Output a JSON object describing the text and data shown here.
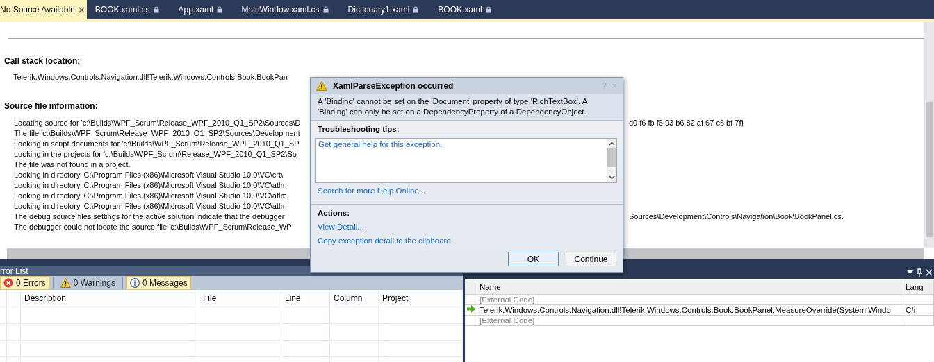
{
  "tabs": [
    {
      "label": "No Source Available",
      "selected": true,
      "locked": false
    },
    {
      "label": "BOOK.xaml.cs",
      "selected": false,
      "locked": true
    },
    {
      "label": "App.xaml",
      "selected": false,
      "locked": true
    },
    {
      "label": "MainWindow.xaml.cs",
      "selected": false,
      "locked": true
    },
    {
      "label": "Dictionary1.xaml",
      "selected": false,
      "locked": true
    },
    {
      "label": "BOOK.xaml",
      "selected": false,
      "locked": true
    }
  ],
  "document": {
    "call_stack_heading": "Call stack location:",
    "call_stack_line": "Telerik.Windows.Controls.Navigation.dll!Telerik.Windows.Controls.Book.BookPan",
    "source_heading": "Source file information:",
    "source_lines": [
      {
        "text": "Locating source for 'c:\\Builds\\WPF_Scrum\\Release_WPF_2010_Q1_SP2\\Sources\\D",
        "tail": "d0 f6 fb f6 93 b6 82 af 67 c6 bf 7f}"
      },
      {
        "text": "The file 'c:\\Builds\\WPF_Scrum\\Release_WPF_2010_Q1_SP2\\Sources\\Development"
      },
      {
        "text": "Looking in script documents for 'c:\\Builds\\WPF_Scrum\\Release_WPF_2010_Q1_SP"
      },
      {
        "text": "Looking in the projects for 'c:\\Builds\\WPF_Scrum\\Release_WPF_2010_Q1_SP2\\So"
      },
      {
        "text": "The file was not found in a project."
      },
      {
        "text": "Looking in directory 'C:\\Program Files (x86)\\Microsoft Visual Studio 10.0\\VC\\crt\\"
      },
      {
        "text": "Looking in directory 'C:\\Program Files (x86)\\Microsoft Visual Studio 10.0\\VC\\atlm"
      },
      {
        "text": "Looking in directory 'C:\\Program Files (x86)\\Microsoft Visual Studio 10.0\\VC\\atlm"
      },
      {
        "text": "Looking in directory 'C:\\Program Files (x86)\\Microsoft Visual Studio 10.0\\VC\\atlm"
      },
      {
        "text": "The debug source files settings for the active solution indicate that the debugger",
        "tail": "Sources\\Development\\Controls\\Navigation\\Book\\BookPanel.cs."
      },
      {
        "text": "The debugger could not locate the source file 'c:\\Builds\\WPF_Scrum\\Release_WP"
      }
    ]
  },
  "dialog": {
    "title": "XamlParseException occurred",
    "help": "?",
    "close": "×",
    "message": "A 'Binding' cannot be set on the 'Document' property of type 'RichTextBox'. A 'Binding' can only be set on a DependencyProperty of a DependencyObject.",
    "tips_heading": "Troubleshooting tips:",
    "tips": [
      "Get general help for this exception."
    ],
    "search_link": "Search for more Help Online...",
    "actions_heading": "Actions:",
    "actions": [
      "View Detail...",
      "Copy exception detail to the clipboard"
    ],
    "buttons": [
      {
        "label": "OK",
        "default": true
      },
      {
        "label": "Continue",
        "default": false
      }
    ]
  },
  "error_list": {
    "title": "rror List",
    "filters": [
      {
        "kind": "error",
        "label": "0 Errors",
        "selected": true
      },
      {
        "kind": "warning",
        "label": "0 Warnings",
        "selected": false
      },
      {
        "kind": "info",
        "label": "0 Messages",
        "selected": true
      }
    ],
    "columns": [
      "Description",
      "File",
      "Line",
      "Column",
      "Project"
    ]
  },
  "call_stack": {
    "columns": [
      "Name",
      "Lang"
    ],
    "rows": [
      {
        "name": "[External Code]",
        "current": false,
        "external": true
      },
      {
        "name": "Telerik.Windows.Controls.Navigation.dll!Telerik.Windows.Controls.Book.BookPanel.MeasureOverride(System.Windo",
        "lang": "C#",
        "current": true,
        "external": false
      },
      {
        "name": "[External Code]",
        "current": false,
        "external": true
      }
    ]
  }
}
